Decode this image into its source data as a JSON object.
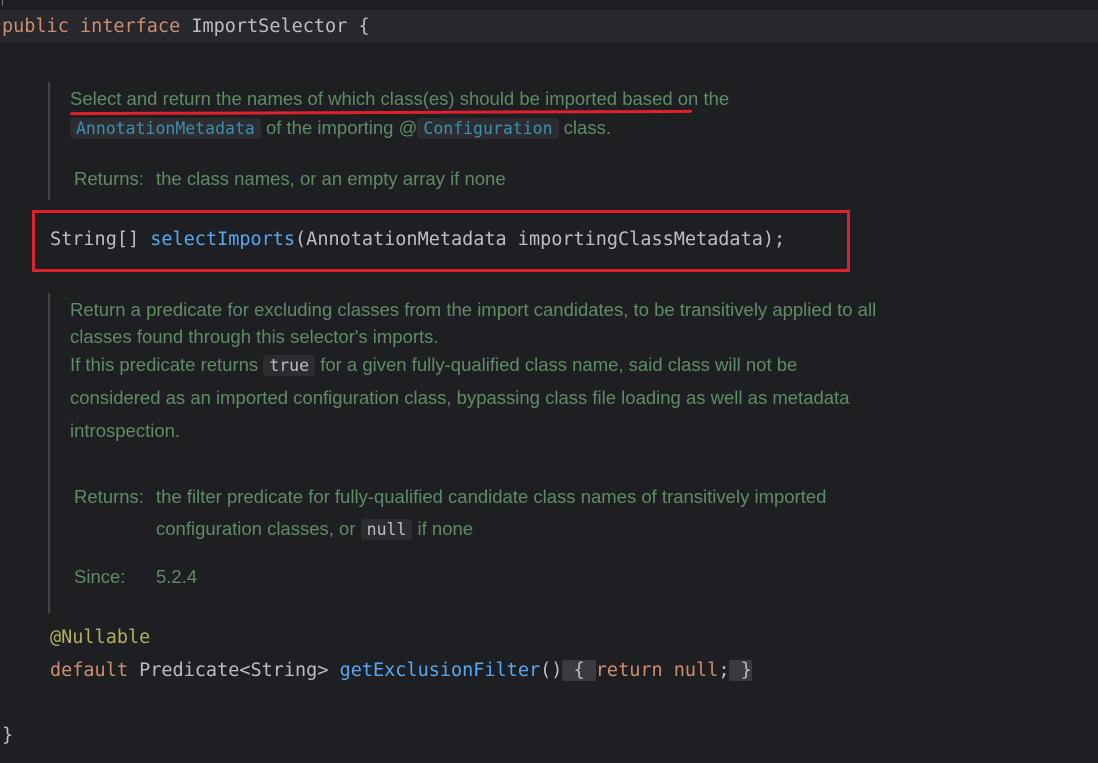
{
  "editor": {
    "header": {
      "kw_public": "public",
      "kw_interface": "interface",
      "name": "ImportSelector",
      "open": "{"
    },
    "doc1": {
      "text1": "Select and return the names of which class(es) should be imported",
      "text2": " based on the",
      "code1": "AnnotationMetadata",
      "text3": " of the importing @",
      "code2": "Configuration",
      "text4": " class.",
      "returns_label": "Returns:",
      "returns_text": "the class names, or an empty array if none"
    },
    "method1": {
      "type": "String[]",
      "name": "selectImports",
      "params": "(AnnotationMetadata importingClassMetadata);"
    },
    "doc2": {
      "p1": "Return a predicate for excluding classes from the import candidates, to be transitively applied to all",
      "p2": "classes found through this selector's imports.",
      "p3a": "If this predicate returns ",
      "p3code": "true",
      "p3b": " for a given fully-qualified class name, said class will not be",
      "p4": "considered as an imported configuration class, bypassing class file loading as well as metadata",
      "p5": "introspection.",
      "returns_label": "Returns:",
      "returns_line1": "the filter predicate for fully-qualified candidate class names of transitively imported",
      "returns_line2a": "configuration classes, or ",
      "returns_code": "null",
      "returns_line2b": " if none",
      "since_label": "Since:",
      "since_value": "5.2.4"
    },
    "method2": {
      "annotation": "@Nullable",
      "kw_default": "default",
      "type": "Predicate<String>",
      "name": "getExclusionFilter",
      "parens": "()",
      "open": "{",
      "kw_return": "return",
      "kw_null": "null",
      "semi": ";",
      "close": "}"
    },
    "footer": {
      "close": "}"
    }
  }
}
